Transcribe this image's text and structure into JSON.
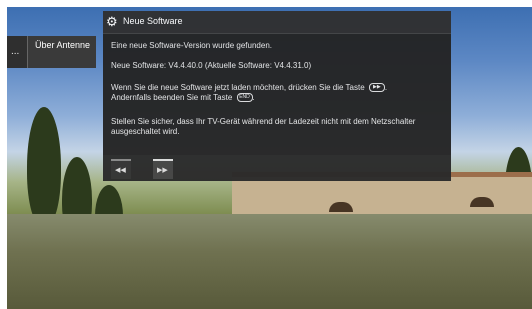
{
  "side_menu": {
    "dots": "...",
    "item_label": "Über Antenne"
  },
  "dialog": {
    "title": "Neue Software",
    "icon": "gear-icon",
    "text_1": "Eine neue Software-Version wurde gefunden.",
    "text_2": "Neue Software:  V4.4.40.0   (Aktuelle Software:  V4.4.31.0)",
    "text_3": "Wenn Sie die neue Software jetzt laden möchten, drücken Sie die Taste",
    "text_4": "Andernfalls beenden Sie mit Taste",
    "text_5": "Stellen Sie sicher, dass Ihr TV-Gerät während der Ladezeit nicht mit dem Netzschalter ausgeschaltet wird.",
    "key_play": "▶▶",
    "key_end": "END"
  },
  "tabs": {
    "left_icon": "rewind-icon",
    "right_icon": "fast-forward-icon"
  }
}
